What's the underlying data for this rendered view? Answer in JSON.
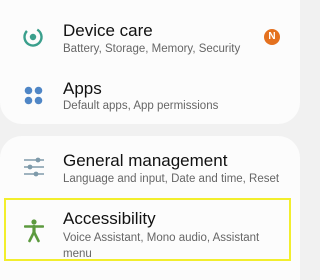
{
  "items": [
    {
      "title": "Device care",
      "subtitle": "Battery, Storage, Memory, Security",
      "badge": "N",
      "icon": "device-care-icon",
      "color": "#3a9f8c"
    },
    {
      "title": "Apps",
      "subtitle": "Default apps, App permissions",
      "icon": "apps-icon",
      "color": "#4f86c6"
    },
    {
      "title": "General management",
      "subtitle": "Language and input, Date and time, Reset",
      "icon": "sliders-icon",
      "color": "#7e9aaa"
    },
    {
      "title": "Accessibility",
      "subtitle": "Voice Assistant, Mono audio, Assistant menu",
      "icon": "accessibility-icon",
      "color": "#5c9a3e"
    }
  ],
  "colors": {
    "highlight": "#f2ee2c",
    "badge": "#e4711f",
    "background": "#f1f1f1",
    "card": "#fcfcfc"
  }
}
